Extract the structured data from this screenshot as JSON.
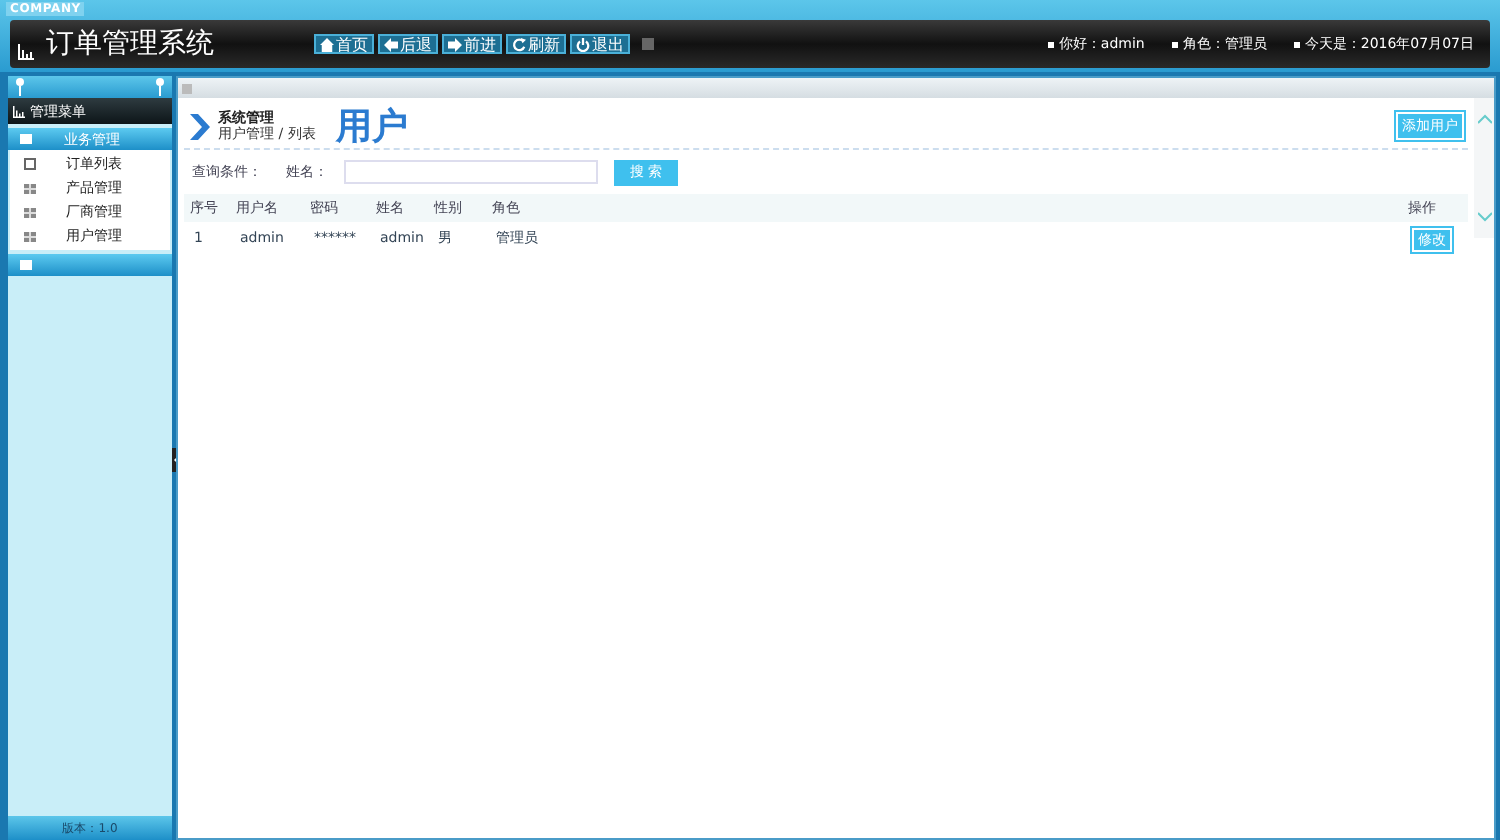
{
  "company": "COMPANY",
  "title": "订单管理系统",
  "nav": [
    {
      "kind": "home",
      "label": "首页"
    },
    {
      "kind": "back",
      "label": "后退"
    },
    {
      "kind": "forward",
      "label": "前进"
    },
    {
      "kind": "refresh",
      "label": "刷新"
    },
    {
      "kind": "power",
      "label": "退出"
    }
  ],
  "user_info": [
    "你好：admin",
    "角色：管理员",
    "今天是：2016年07月07日"
  ],
  "sidebar": {
    "title": "管理菜单",
    "groups": [
      {
        "label": "业务管理",
        "expanded": true,
        "items": [
          {
            "kind": "doc",
            "label": "订单列表"
          },
          {
            "kind": "grid",
            "label": "产品管理"
          },
          {
            "kind": "grid",
            "label": "厂商管理"
          },
          {
            "kind": "grid",
            "label": "用户管理"
          }
        ]
      },
      {
        "expanded": false
      }
    ],
    "footer": "版本：1.0"
  },
  "breadcrumb": {
    "section": "系统管理",
    "path": "用户管理 / 列表",
    "heading": "用户"
  },
  "add_button": "添加用户",
  "search": {
    "criteria_label": "查询条件：",
    "name_label": "姓名：",
    "button": "搜 索"
  },
  "table": {
    "columns": [
      "序号",
      "用户名",
      "密码",
      "姓名",
      "性别",
      "角色",
      "操作"
    ],
    "rows": [
      {
        "cells": [
          "1",
          "admin",
          "******",
          "admin",
          "男",
          "管理员"
        ],
        "action": "修改"
      }
    ]
  }
}
